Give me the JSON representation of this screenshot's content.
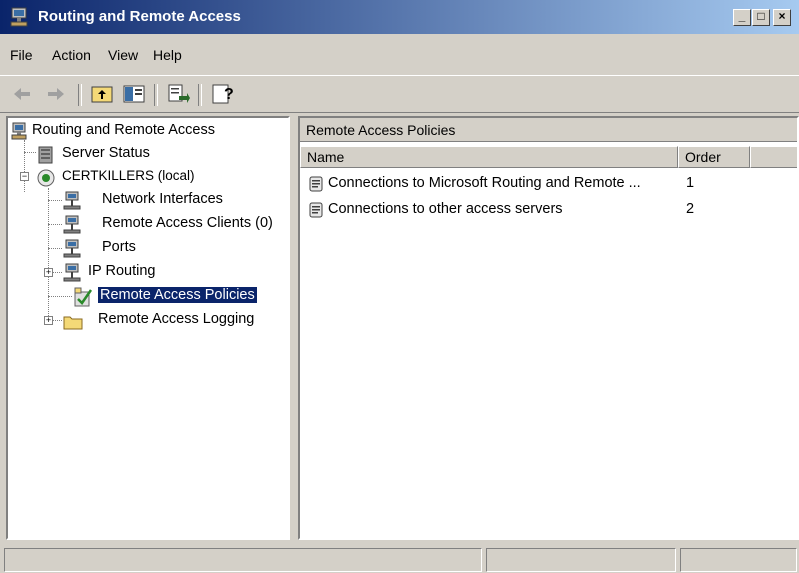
{
  "window": {
    "title": "Routing and Remote Access",
    "minimize_label": "_",
    "maximize_label": "□",
    "close_label": "×"
  },
  "menu": {
    "items": [
      {
        "label": "File"
      },
      {
        "label": "Action"
      },
      {
        "label": "View"
      },
      {
        "label": "Help"
      }
    ]
  },
  "toolbar": {
    "buttons": [
      "back-arrow-icon",
      "forward-arrow-icon",
      "up-folder-icon",
      "show-hide-tree-icon",
      "export-list-icon",
      "help-icon"
    ]
  },
  "tree": {
    "root": {
      "label": "Routing and Remote Access"
    },
    "server_status": {
      "label": "Server Status"
    },
    "server": {
      "label": "CERTKILLERS (local)",
      "expanded": true
    },
    "children": [
      {
        "label": "Network Interfaces"
      },
      {
        "label": "Remote Access Clients (0)"
      },
      {
        "label": "Ports"
      },
      {
        "label": "IP Routing",
        "expandable": true
      },
      {
        "label": "Remote Access Policies",
        "selected": true
      },
      {
        "label": "Remote Access Logging",
        "expandable": true
      }
    ]
  },
  "details": {
    "title": "Remote Access Policies",
    "columns": {
      "name": "Name",
      "order": "Order"
    },
    "rows": [
      {
        "name": "Connections to Microsoft Routing and Remote ...",
        "order": "1"
      },
      {
        "name": "Connections to other access servers",
        "order": "2"
      }
    ]
  },
  "colors": {
    "titlebar_start": "#0a246a",
    "titlebar_end": "#a6caf0",
    "selection": "#0a246a",
    "face": "#d4d0c8"
  }
}
